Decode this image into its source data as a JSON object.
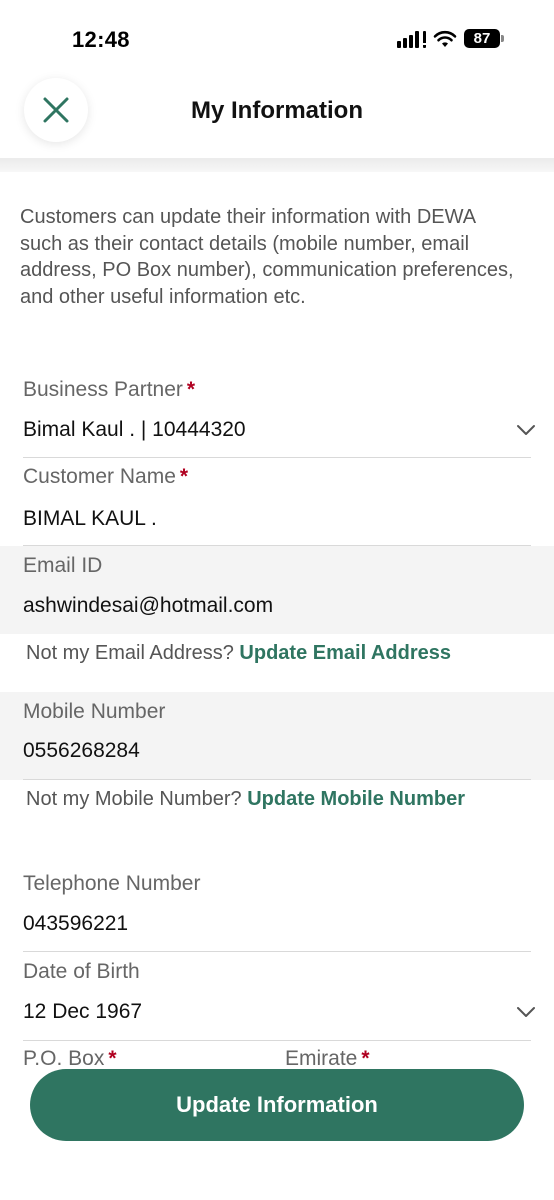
{
  "status_bar": {
    "time": "12:48",
    "battery": "87"
  },
  "header": {
    "title": "My Information",
    "close_icon": "close-icon"
  },
  "description": "Customers can update their information with DEWA such as their contact details (mobile number, email address, PO Box number), communication preferences, and other useful information etc.",
  "form": {
    "business_partner": {
      "label": "Business Partner",
      "required": "*",
      "value": "Bimal Kaul . | 10444320"
    },
    "customer_name": {
      "label": "Customer Name",
      "required": "*",
      "value": "BIMAL KAUL ."
    },
    "email": {
      "label": "Email ID",
      "value": "ashwindesai@hotmail.com",
      "helper_text": "Not my Email Address?",
      "helper_link": "Update Email Address"
    },
    "mobile": {
      "label": "Mobile Number",
      "value": "0556268284",
      "helper_text": "Not my Mobile Number?",
      "helper_link": "Update Mobile Number"
    },
    "telephone": {
      "label": "Telephone Number",
      "value": "043596221"
    },
    "dob": {
      "label": "Date of Birth",
      "value": "12 Dec 1967"
    },
    "po_box": {
      "label": "P.O. Box",
      "required": "*"
    },
    "emirate": {
      "label": "Emirate",
      "required": "*"
    }
  },
  "actions": {
    "update_label": "Update Information"
  },
  "colors": {
    "accent": "#2f7561",
    "required": "#b00020"
  }
}
